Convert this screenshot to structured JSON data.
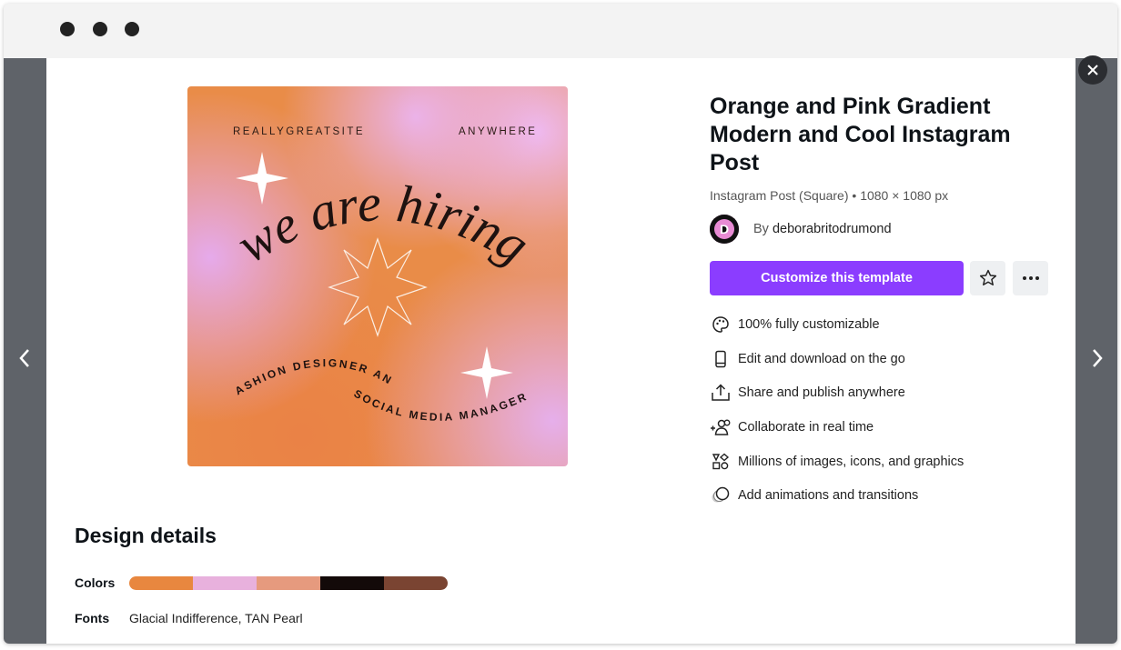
{
  "preview": {
    "top_left": "REALLYGREATSITE",
    "top_right": "ANYWHERE",
    "headline": "we are hiring",
    "subline_1": "FASHION DESIGNER AND",
    "subline_2": "SOCIAL MEDIA MANAGER"
  },
  "template": {
    "title": "Orange and Pink Gradient Modern and Cool Instagram Post",
    "meta": "Instagram Post (Square) • 1080 × 1080 px",
    "author_prefix": "By",
    "author_name": "deborabritodrumond",
    "avatar_letter": "D",
    "cta_label": "Customize this template"
  },
  "features": [
    {
      "icon": "palette-icon",
      "label": "100% fully customizable"
    },
    {
      "icon": "phone-icon",
      "label": "Edit and download on the go"
    },
    {
      "icon": "share-icon",
      "label": "Share and publish anywhere"
    },
    {
      "icon": "collaborate-icon",
      "label": "Collaborate in real time"
    },
    {
      "icon": "elements-icon",
      "label": "Millions of images, icons, and graphics"
    },
    {
      "icon": "animation-icon",
      "label": "Add animations and transitions"
    }
  ],
  "details": {
    "title": "Design details",
    "colors_label": "Colors",
    "colors": [
      "#e8873f",
      "#e8b1dd",
      "#e69a7e",
      "#130a09",
      "#7a4432"
    ],
    "fonts_label": "Fonts",
    "fonts_value": "Glacial Indifference, TAN Pearl"
  },
  "theme": {
    "accent": "#8b3dff"
  }
}
